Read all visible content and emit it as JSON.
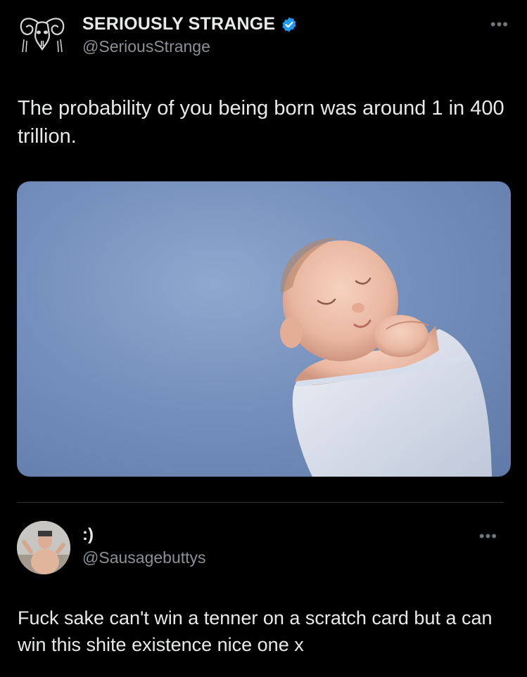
{
  "post": {
    "display_name": "SERIOUSLY STRANGE",
    "handle": "@SeriousStrange",
    "verified": true,
    "more_label": "•••",
    "text": "The probability of you being born was around 1 in 400 trillion.",
    "media_alt": "Photo of a sleeping newborn baby swaddled in a white blanket on a blue background",
    "accent_color": "#1d9bf0"
  },
  "reply": {
    "display_name": ":)",
    "handle": "@Sausagebuttys",
    "more_label": "•••",
    "text": "Fuck sake can't win a tenner on a scratch card but a can win this shite existence nice one x"
  }
}
